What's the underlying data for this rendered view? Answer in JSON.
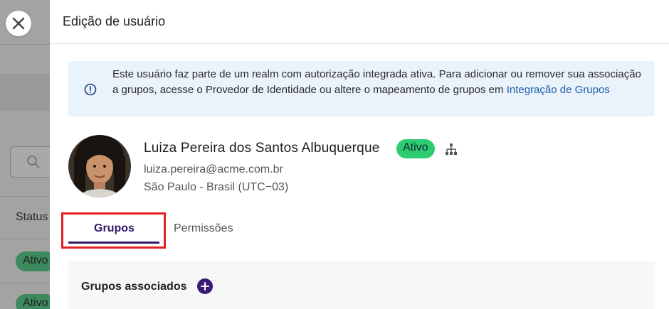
{
  "background": {
    "status_label": "Status",
    "pills": [
      "Ativo",
      "Ativo"
    ]
  },
  "drawer": {
    "title": "Edição de usuário",
    "info": {
      "text": "Este usuário faz parte de um realm com autorização integrada ativa. Para adicionar ou remover sua associação a grupos, acesse o Provedor de Identidade ou altere o mapeamento de grupos em ",
      "link": "Integração de Grupos"
    },
    "user": {
      "name": "Luiza Pereira dos Santos Albuquerque",
      "status": "Ativo",
      "email": "luiza.pereira@acme.com.br",
      "location": "São Paulo - Brasil (UTC−03)"
    },
    "tabs": [
      {
        "label": "Grupos",
        "active": true
      },
      {
        "label": "Permissões",
        "active": false
      }
    ],
    "groups_section": {
      "title": "Grupos associados"
    }
  },
  "colors": {
    "accent": "#2f1a6a",
    "status_green": "#2ecc71",
    "link_blue": "#1f5fa8",
    "info_bg": "#eaf2fb",
    "highlight_red": "#e51f1f"
  },
  "icons": [
    "close-icon",
    "search-icon",
    "info-icon",
    "hierarchy-icon",
    "plus-icon"
  ]
}
